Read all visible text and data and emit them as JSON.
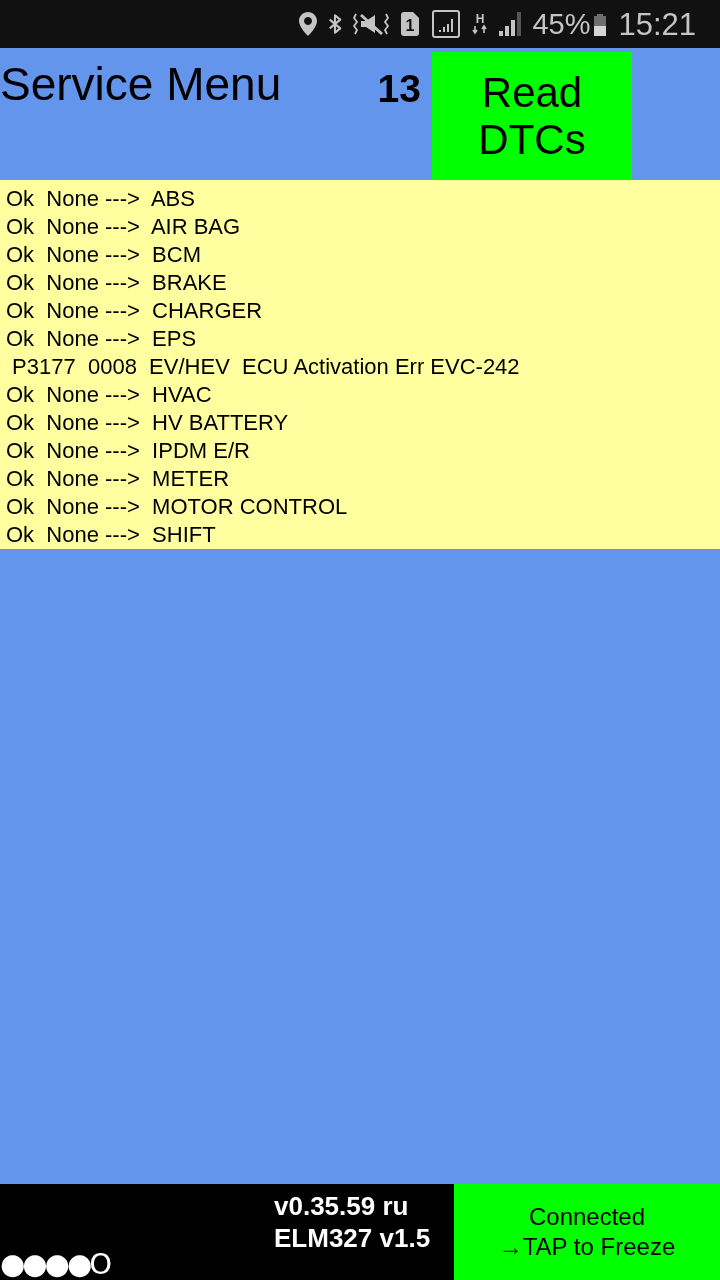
{
  "status_bar": {
    "sim_label": "1",
    "network_type": "H",
    "battery": "45%",
    "time": "15:21"
  },
  "header": {
    "title": "Service Menu",
    "count": "13",
    "read_button": "Read\nDTCs"
  },
  "dtc_list": [
    "Ok  None --->  ABS",
    "Ok  None --->  AIR BAG",
    "Ok  None --->  BCM",
    "Ok  None --->  BRAKE",
    "Ok  None --->  CHARGER",
    "Ok  None --->  EPS",
    " P3177  0008  EV/HEV  ECU Activation Err EVC-242",
    "Ok  None --->  HVAC",
    "Ok  None --->  HV BATTERY",
    "Ok  None --->  IPDM E/R",
    "Ok  None --->  METER",
    "Ok  None --->  MOTOR CONTROL",
    "Ok  None --->  SHIFT"
  ],
  "footer": {
    "indicator": "●●●●O",
    "version": "v0.35.59 ru",
    "adapter": "ELM327 v1.5",
    "connection_button": "Connected\n→TAP to Freeze"
  }
}
